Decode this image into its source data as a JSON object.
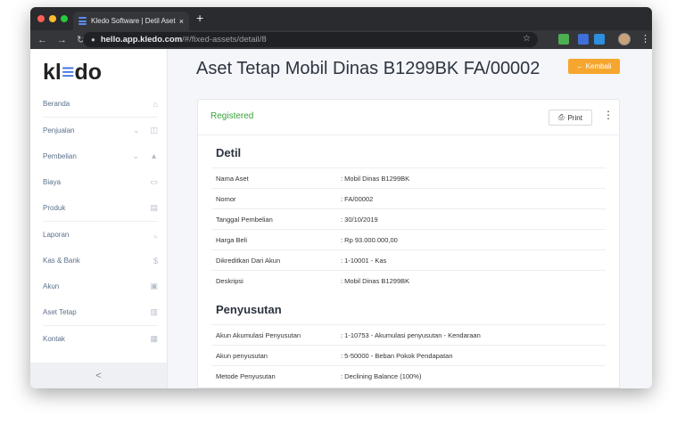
{
  "browser": {
    "tab_title": "Kledo Software | Detil Aset Teta",
    "tab_close": "×",
    "new_tab": "+",
    "url_host": "hello.app.kledo.com",
    "url_path": "/#/fixed-assets/detail/8",
    "icons": [
      "back-arrow-icon",
      "forward-arrow-icon",
      "reload-icon",
      "lock-icon",
      "star-icon",
      "extension-icon",
      "profile-avatar",
      "kebab-menu-icon"
    ]
  },
  "app": {
    "logo_pre": "kl",
    "logo_e": "≡",
    "logo_post": "do",
    "collapse_label": "<"
  },
  "sidebar": {
    "items": [
      {
        "label": "Beranda",
        "icon": "home-icon",
        "chevron": ""
      },
      {
        "label": "Penjualan",
        "icon": "basket-icon",
        "chevron": "⌄"
      },
      {
        "label": "Pembelian",
        "icon": "bag-icon",
        "chevron": "⌄"
      },
      {
        "label": "Biaya",
        "icon": "card-icon",
        "chevron": ""
      },
      {
        "label": "Produk",
        "icon": "box-icon",
        "chevron": ""
      },
      {
        "label": "Laporan",
        "icon": "chart-icon",
        "chevron": ""
      },
      {
        "label": "Kas & Bank",
        "icon": "dollar-icon",
        "chevron": ""
      },
      {
        "label": "Akun",
        "icon": "book-icon",
        "chevron": ""
      },
      {
        "label": "Aset Tetap",
        "icon": "building-icon",
        "chevron": ""
      },
      {
        "label": "Kontak",
        "icon": "contact-card-icon",
        "chevron": ""
      }
    ]
  },
  "page": {
    "title": "Aset Tetap Mobil Dinas B1299BK FA/00002",
    "back_label": "← Kembali",
    "status": "Registered",
    "print_label": "Print",
    "more_label": "⋮"
  },
  "detail": {
    "title": "Detil",
    "rows": [
      {
        "key": "Nama Aset",
        "value": ": Mobil Dinas B1299BK"
      },
      {
        "key": "Nomor",
        "value": ": FA/00002"
      },
      {
        "key": "Tanggal Pembelian",
        "value": ": 30/10/2019"
      },
      {
        "key": "Harga Beli",
        "value": ": Rp 93.000.000,00"
      },
      {
        "key": "Dikreditkan Dari Akun",
        "value": ": 1-10001 - Kas"
      },
      {
        "key": "Deskripsi",
        "value": ": Mobil Dinas B1299BK"
      }
    ]
  },
  "depreciation": {
    "title": "Penyusutan",
    "rows": [
      {
        "key": "Akun Akumulasi Penyusutan",
        "value": ": 1-10753 - Akumulasi penyusutan - Kendaraan"
      },
      {
        "key": "Akun penyusutan",
        "value": ": 5-50000 - Beban Pokok Pendapatan"
      },
      {
        "key": "Metode Penyusutan",
        "value": ": Declining Balance (100%)"
      }
    ]
  },
  "colors": {
    "accent": "#f6a62e",
    "status": "#3aa33a",
    "logo_accent": "#3b6fe0"
  }
}
